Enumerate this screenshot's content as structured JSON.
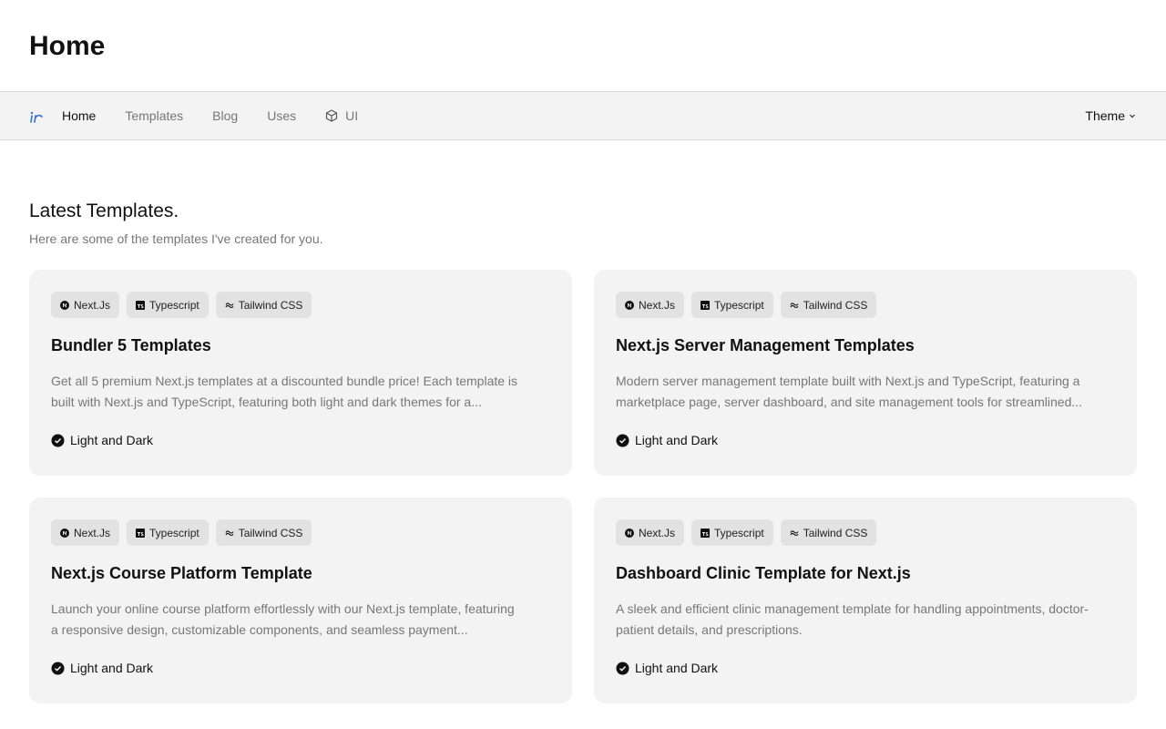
{
  "header": {
    "title": "Home"
  },
  "nav": {
    "items": [
      {
        "label": "Home",
        "active": true
      },
      {
        "label": "Templates",
        "active": false
      },
      {
        "label": "Blog",
        "active": false
      },
      {
        "label": "Uses",
        "active": false
      },
      {
        "label": "UI",
        "active": false,
        "icon": "cube-icon"
      }
    ],
    "theme_label": "Theme"
  },
  "section": {
    "title": "Latest Templates.",
    "subtitle": "Here are some of the templates I've created for you."
  },
  "cards": [
    {
      "tags": [
        "Next.Js",
        "Typescript",
        "Tailwind CSS"
      ],
      "title": "Bundler 5 Templates",
      "description": "Get all 5 premium Next.js templates at a discounted bundle price! Each template is built with Next.js and TypeScript, featuring both light and dark themes for a...",
      "feature": "Light and Dark"
    },
    {
      "tags": [
        "Next.Js",
        "Typescript",
        "Tailwind CSS"
      ],
      "title": "Next.js Server Management Templates",
      "description": "Modern server management template built with Next.js and TypeScript, featuring a marketplace page, server dashboard, and site management tools for streamlined...",
      "feature": "Light and Dark"
    },
    {
      "tags": [
        "Next.Js",
        "Typescript",
        "Tailwind CSS"
      ],
      "title": "Next.js Course Platform Template",
      "description": "Launch your online course platform effortlessly with our Next.js template, featuring a responsive design, customizable components, and seamless payment...",
      "feature": "Light and Dark"
    },
    {
      "tags": [
        "Next.Js",
        "Typescript",
        "Tailwind CSS"
      ],
      "title": "Dashboard Clinic Template for Next.js",
      "description": "A sleek and efficient clinic management template for handling appointments, doctor-patient details, and prescriptions.",
      "feature": "Light and Dark"
    }
  ],
  "colors": {
    "accent": "#2f6fd6",
    "card_bg": "#f3f3f3",
    "tag_bg": "#e2e2e2"
  }
}
